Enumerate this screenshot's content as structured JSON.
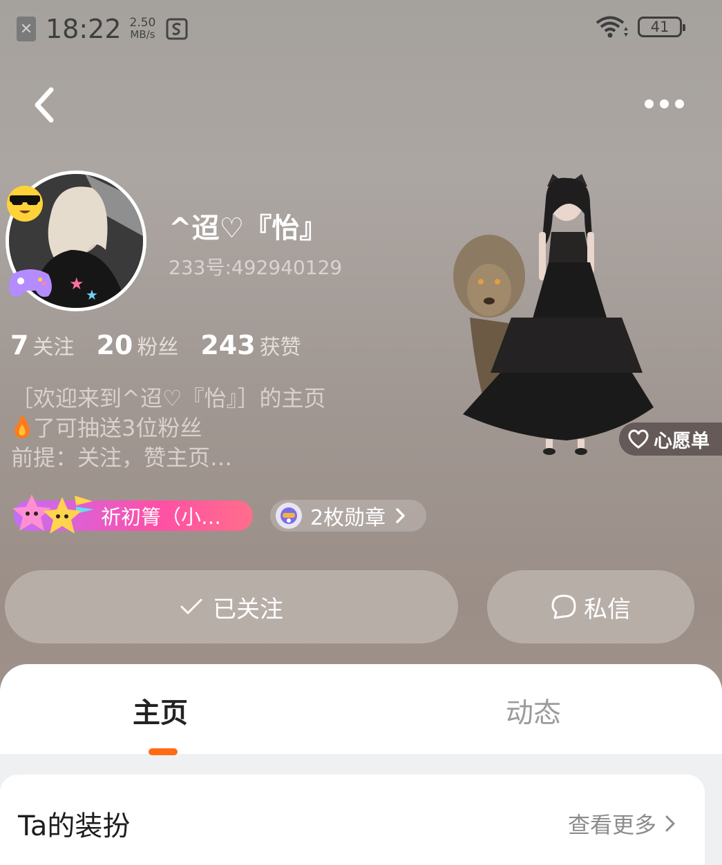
{
  "status_bar": {
    "time": "18:22",
    "speed_value": "2.50",
    "speed_unit": "MB/s",
    "battery": "41"
  },
  "profile": {
    "nickname": "^迢♡『怡』",
    "uid": "233号:492940129",
    "stats": [
      {
        "num": "7",
        "label": "关注"
      },
      {
        "num": "20",
        "label": "粉丝"
      },
      {
        "num": "243",
        "label": "获赞"
      }
    ],
    "bio_line1": "［欢迎来到^迢♡『怡』］的主页",
    "bio_line2": "了可抽送3位粉丝",
    "bio_line3": "前提：关注，赞主页…",
    "wishlist_label": "心愿单",
    "tag_label": "祈初箐（小…",
    "medals_label": "2枚勋章"
  },
  "actions": {
    "follow_label": "已关注",
    "message_label": "私信"
  },
  "tabs": [
    {
      "label": "主页",
      "active": true
    },
    {
      "label": "动态",
      "active": false
    }
  ],
  "section": {
    "title": "Ta的装扮",
    "more_label": "查看更多"
  },
  "colors": {
    "accent": "#ff6a13",
    "tag_gradient_start": "#c36ef7",
    "tag_gradient_end": "#ff4fa6"
  }
}
